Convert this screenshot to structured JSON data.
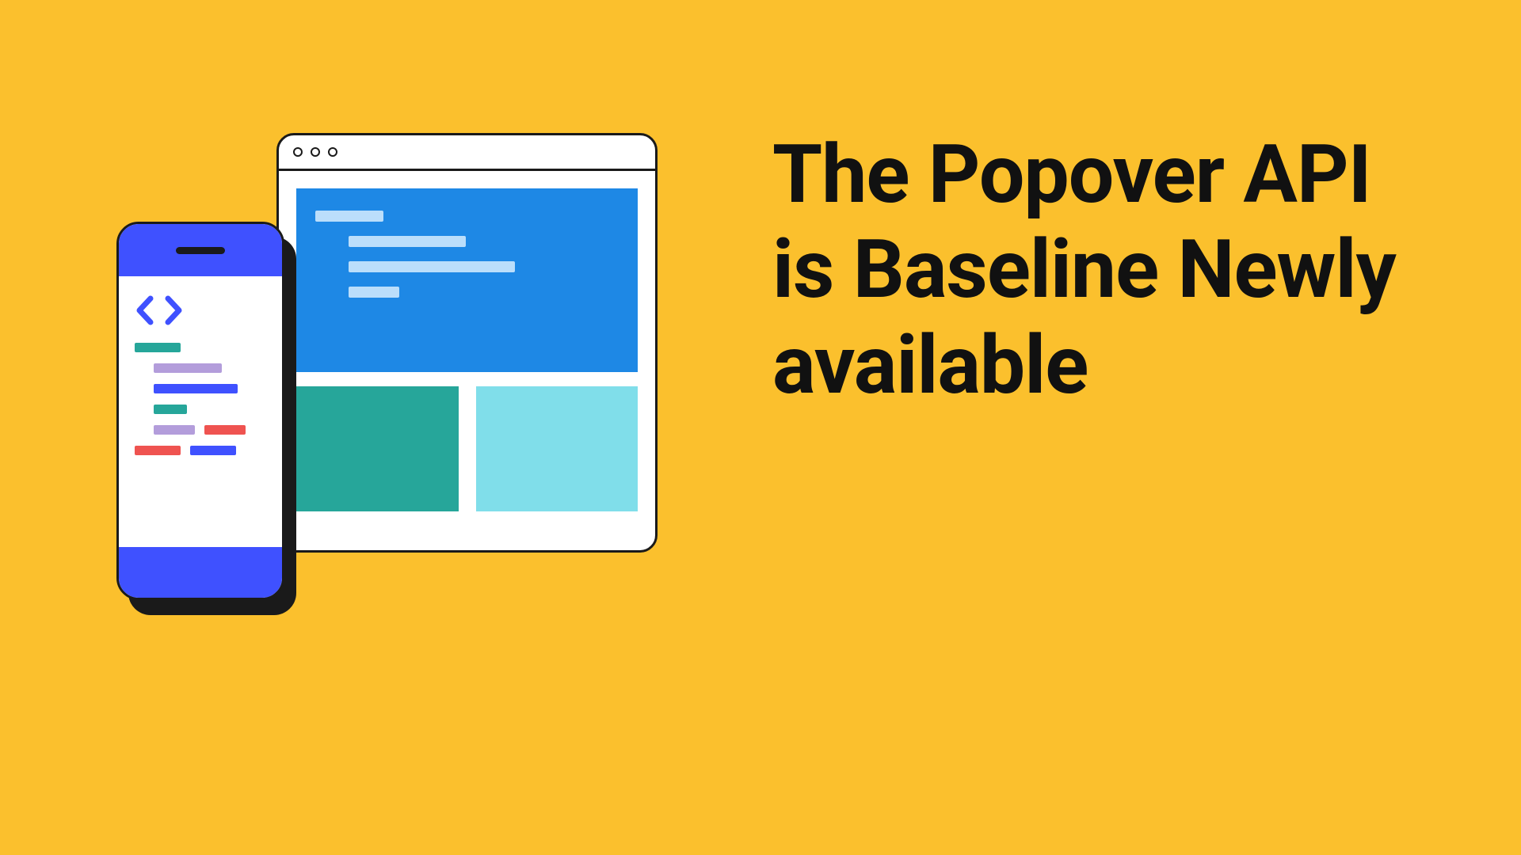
{
  "headline": "The Popover API is Baseline Newly available",
  "colors": {
    "background": "#fbc02d",
    "text": "#111111",
    "browser_hero": "#1e88e5",
    "tile_green": "#26a69a",
    "tile_cyan": "#80deea",
    "phone_accent": "#3f51ff",
    "code_green": "#26a69a",
    "code_purple": "#b39ddb",
    "code_blue": "#3f51ff",
    "code_red": "#ef5350"
  },
  "icons": {
    "angle_left": "angle-bracket-left-icon",
    "angle_right": "angle-bracket-right-icon",
    "traffic_dot": "window-control-dot"
  }
}
